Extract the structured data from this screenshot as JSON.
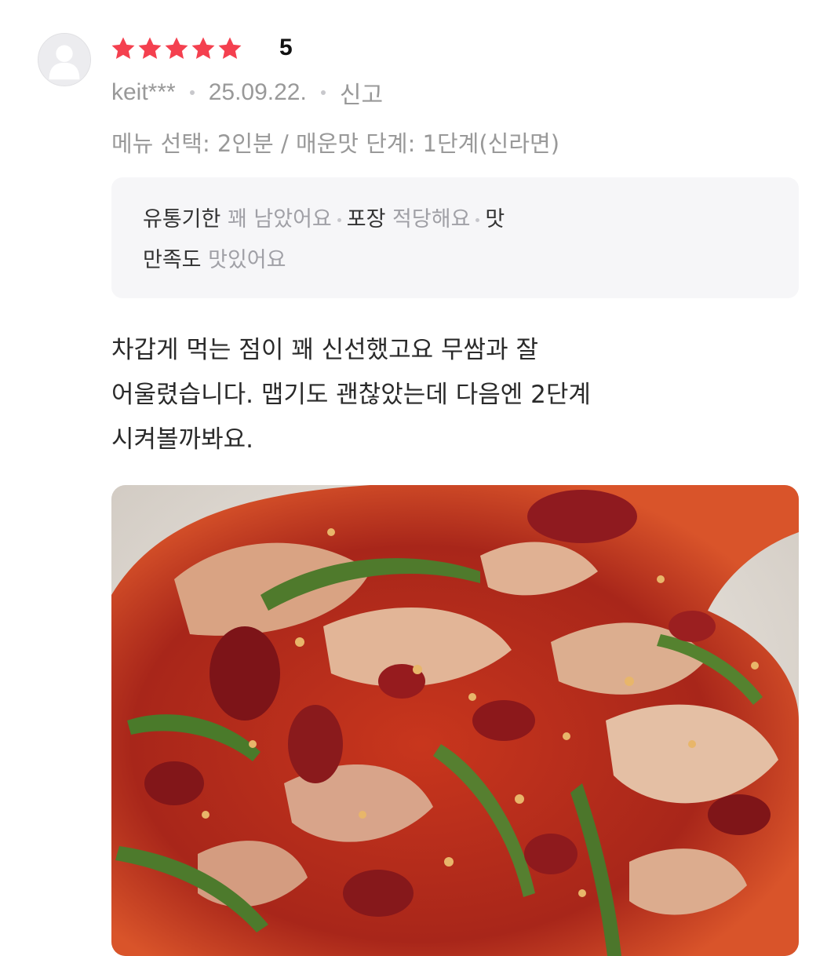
{
  "review": {
    "rating_value": "5",
    "star_count": 5,
    "star_color": "#f4404f",
    "user_name": "keit***",
    "date": "25.09.22.",
    "report_label": "신고",
    "option_text": "메뉴 선택: 2인분 / 매운맛 단계: 1단계(신라면)",
    "tags": [
      {
        "key": "유통기한",
        "value": "꽤 남았어요"
      },
      {
        "key": "포장",
        "value": "적당해요"
      },
      {
        "key": "맛",
        "value": ""
      },
      {
        "key": "만족도",
        "value": "맛있어요"
      }
    ],
    "body_lines": [
      "차갑게 먹는 점이 꽤 신선했고요 무쌈과 잘",
      "어울렸습니다. 맵기도 괜찮았는데 다음엔 2단계",
      "시켜볼까봐요."
    ],
    "photo_subject": "review-food-photo",
    "avatar_icon": "default-user-icon"
  }
}
